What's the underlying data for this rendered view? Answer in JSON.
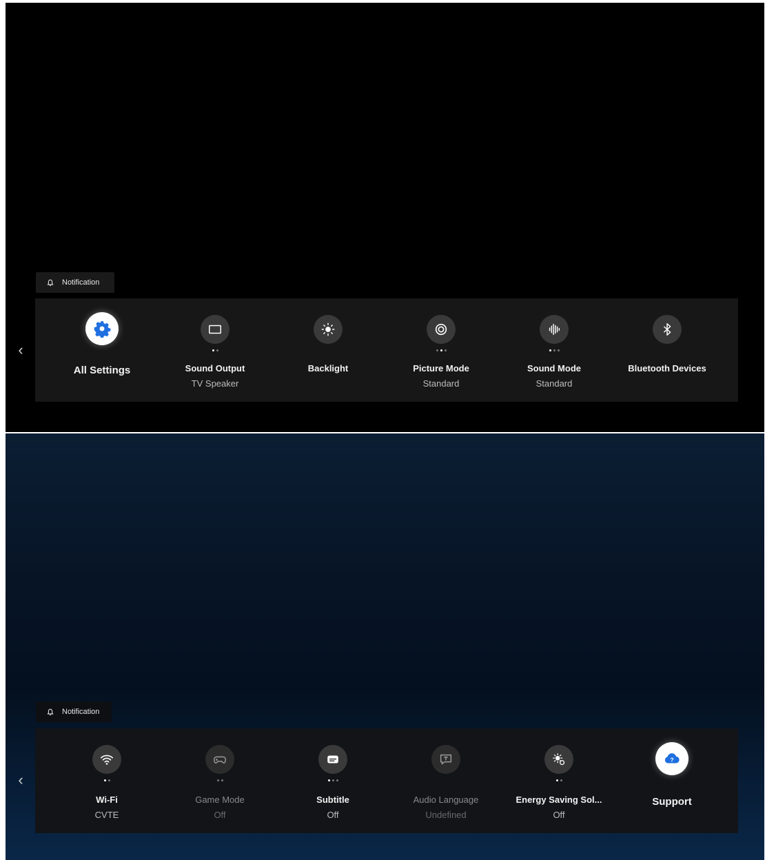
{
  "colors": {
    "tray_bg": "#171717",
    "icon_bg": "#3a3a3a",
    "accent": "#1f6fe0"
  },
  "top_panel": {
    "notification": {
      "icon": "bell-icon",
      "label": "Notification"
    },
    "tiles": [
      {
        "icon": "gear-icon",
        "label": "All Settings",
        "sub": ""
      },
      {
        "icon": "screen-icon",
        "label": "Sound Output",
        "sub": "TV Speaker"
      },
      {
        "icon": "brightness-icon",
        "label": "Backlight",
        "sub": ""
      },
      {
        "icon": "picture-mode-icon",
        "label": "Picture Mode",
        "sub": "Standard"
      },
      {
        "icon": "soundwave-icon",
        "label": "Sound Mode",
        "sub": "Standard"
      },
      {
        "icon": "bluetooth-icon",
        "label": "Bluetooth Devices",
        "sub": ""
      }
    ]
  },
  "bottom_panel": {
    "notification": {
      "icon": "bell-icon",
      "label": "Notification"
    },
    "tiles": [
      {
        "icon": "wifi-icon",
        "label": "Wi-Fi",
        "sub": "CVTE"
      },
      {
        "icon": "gamepad-icon",
        "label": "Game Mode",
        "sub": "Off"
      },
      {
        "icon": "subtitle-icon",
        "label": "Subtitle",
        "sub": "Off"
      },
      {
        "icon": "audio-language-icon",
        "label": "Audio Language",
        "sub": "Undefined"
      },
      {
        "icon": "energy-saving-icon",
        "label": "Energy Saving Sol...",
        "sub": "Off"
      },
      {
        "icon": "support-icon",
        "label": "Support",
        "sub": ""
      }
    ]
  }
}
